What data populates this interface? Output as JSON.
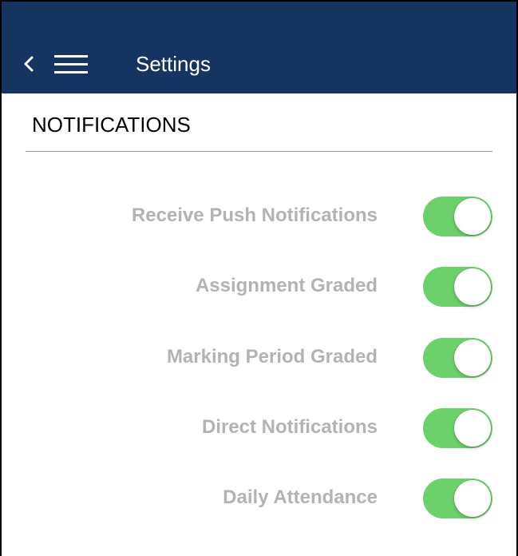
{
  "header": {
    "title": "Settings",
    "back_icon": "chevron-left-icon",
    "menu_icon": "hamburger-menu-icon",
    "background_color": "#163461"
  },
  "section": {
    "title": "NOTIFICATIONS"
  },
  "settings": [
    {
      "label": "Receive Push Notifications",
      "enabled": true
    },
    {
      "label": "Assignment Graded",
      "enabled": true
    },
    {
      "label": "Marking Period Graded",
      "enabled": true
    },
    {
      "label": "Direct Notifications",
      "enabled": true
    },
    {
      "label": "Daily Attendance",
      "enabled": true
    }
  ],
  "colors": {
    "toggle_on": "#6cd16b",
    "label_text": "#b3b3b3"
  }
}
